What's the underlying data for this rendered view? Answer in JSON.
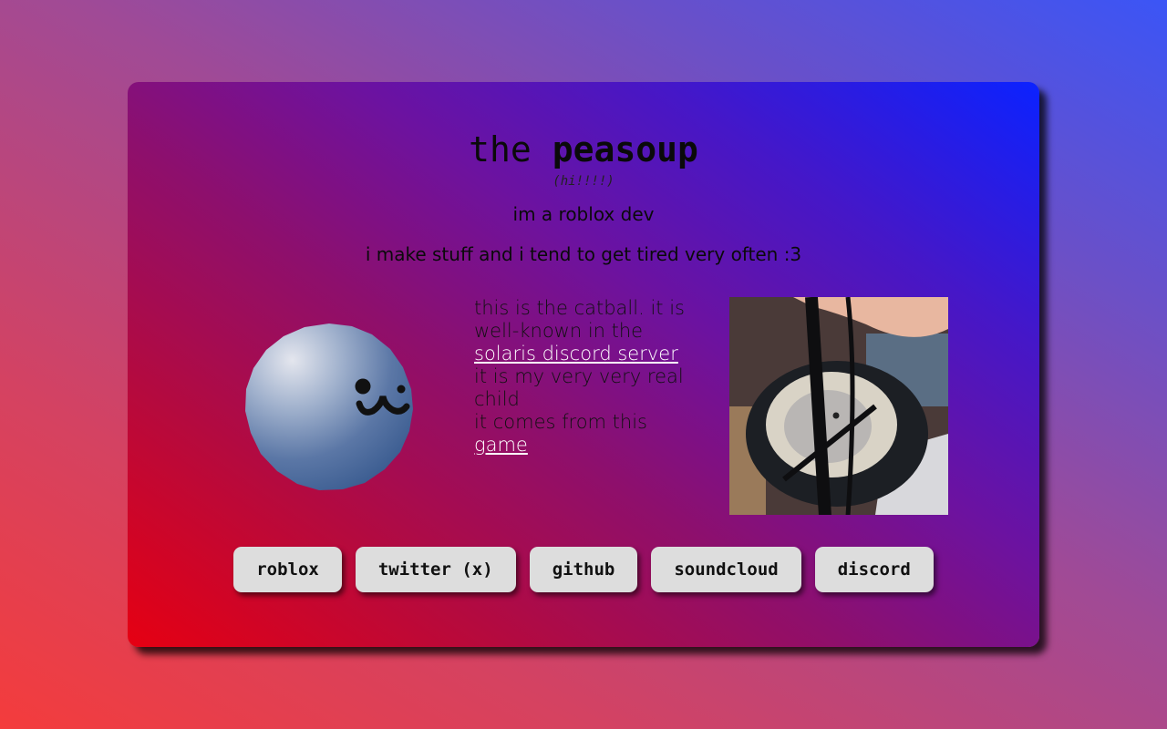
{
  "header": {
    "title_plain": "the",
    "title_bold": "peasoup",
    "subtitle": "(hi!!!!)"
  },
  "intro": {
    "line1": "im a roblox dev",
    "line2": "i make stuff and i tend to get tired very often :3"
  },
  "catball": {
    "text_before": "this is the catball. it is well-known in the",
    "link_server": "solaris discord server",
    "text_middle1": "it is my very very real child",
    "text_middle2": "it comes from this",
    "link_game": "game"
  },
  "buttons": [
    {
      "label": "roblox"
    },
    {
      "label": "twitter (x)"
    },
    {
      "label": "github"
    },
    {
      "label": "soundcloud"
    },
    {
      "label": "discord"
    }
  ],
  "colors": {
    "card_gradient_start": "#e60012",
    "card_gradient_end": "#0b22ff",
    "button_bg": "#dddddd",
    "link": "#ffffff"
  }
}
